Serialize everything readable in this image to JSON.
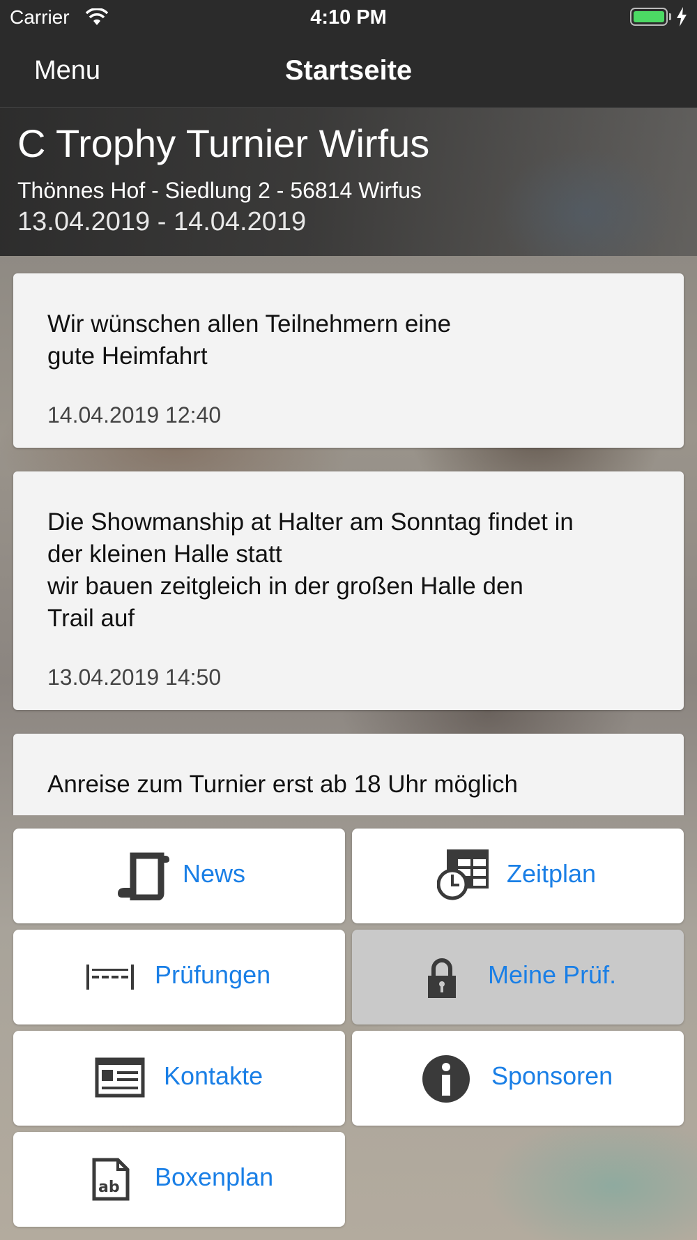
{
  "status_bar": {
    "carrier": "Carrier",
    "time": "4:10 PM"
  },
  "nav": {
    "menu_label": "Menu",
    "title": "Startseite"
  },
  "event": {
    "title": "C Trophy Turnier Wirfus",
    "address": "Thönnes Hof - Siedlung 2 - 56814 Wirfus",
    "dates": "13.04.2019 - 14.04.2019"
  },
  "news": [
    {
      "line1": "Wir wünschen allen Teilnehmern eine",
      "line2": "gute Heimfahrt",
      "date": "14.04.2019 12:40"
    },
    {
      "line1": "Die Showmanship at Halter am Sonntag findet in",
      "line2": "der kleinen Halle statt",
      "line3": "wir bauen zeitgleich in der großen Halle den",
      "line4": "Trail auf",
      "date": "13.04.2019 14:50"
    },
    {
      "line1": "Anreise zum Turnier erst ab 18 Uhr möglich"
    }
  ],
  "tiles": {
    "news": {
      "label": "News",
      "icon": "scroll-icon"
    },
    "zeitplan": {
      "label": "Zeitplan",
      "icon": "schedule-clock-icon"
    },
    "pruefungen": {
      "label": "Prüfungen",
      "icon": "distance-icon"
    },
    "meine_pruef": {
      "label": "Meine Prüf.",
      "icon": "lock-icon",
      "state": "disabled"
    },
    "kontakte": {
      "label": "Kontakte",
      "icon": "contact-card-icon"
    },
    "sponsoren": {
      "label": "Sponsoren",
      "icon": "info-icon"
    },
    "boxenplan": {
      "label": "Boxenplan",
      "icon": "document-ab-icon"
    }
  },
  "colors": {
    "bars": "#2b2b2b",
    "link": "#1a7fe6",
    "battery": "#4cd964"
  }
}
